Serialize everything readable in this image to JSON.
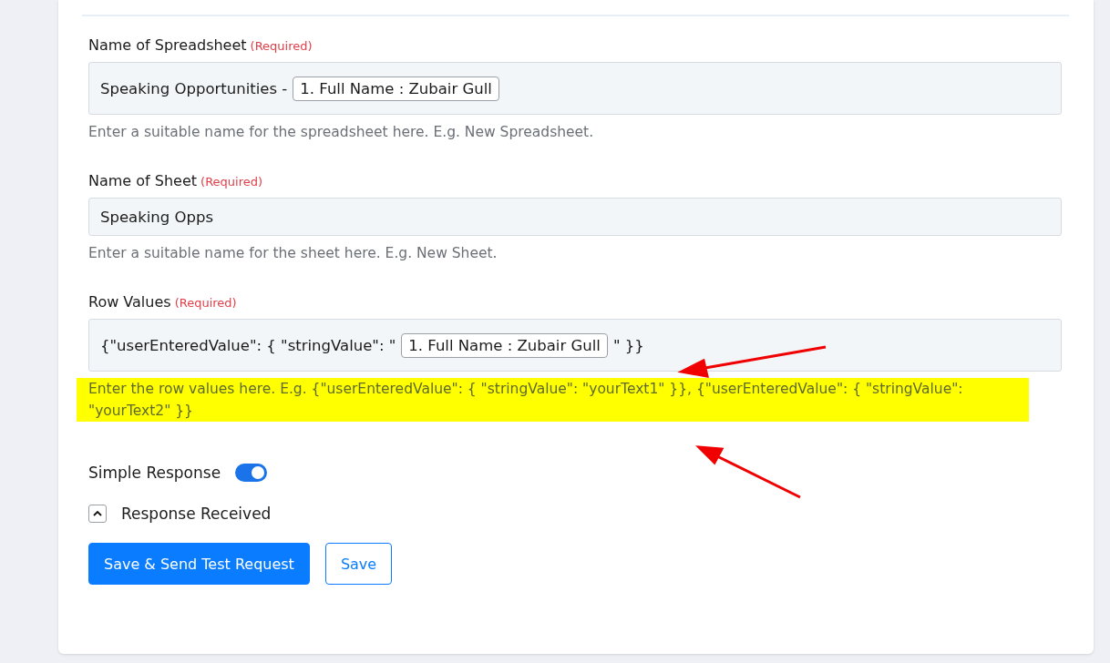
{
  "fields": [
    {
      "label": "Name of Spreadsheet",
      "required": "(Required)",
      "value": [
        {
          "kind": "text",
          "text": "Speaking Opportunities -"
        },
        {
          "kind": "token",
          "text": "1. Full Name : Zubair Gull"
        }
      ],
      "help": "Enter a suitable name for the spreadsheet here. E.g. New Spreadsheet.",
      "highlighted": false
    },
    {
      "label": "Name of Sheet",
      "required": "(Required)",
      "value": [
        {
          "kind": "text",
          "text": "Speaking Opps"
        }
      ],
      "help": "Enter a suitable name for the sheet here. E.g. New Sheet.",
      "highlighted": false
    },
    {
      "label": "Row Values",
      "required": "(Required)",
      "value": [
        {
          "kind": "text",
          "text": "{\"userEnteredValue\": { \"stringValue\": \""
        },
        {
          "kind": "token",
          "text": "1. Full Name : Zubair Gull"
        },
        {
          "kind": "text",
          "text": "\" }}"
        }
      ],
      "help": "Enter the row values here. E.g. {\"userEnteredValue\": { \"stringValue\": \"yourText1\" }}, {\"userEnteredValue\": { \"stringValue\": \"yourText2\" }}",
      "highlighted": true
    }
  ],
  "simple_response": {
    "label": "Simple Response",
    "on": true
  },
  "response_received": {
    "label": "Response Received",
    "expanded": true
  },
  "buttons": [
    {
      "label": "Save & Send Test Request",
      "kind": "primary"
    },
    {
      "label": "Save",
      "kind": "outline"
    }
  ]
}
